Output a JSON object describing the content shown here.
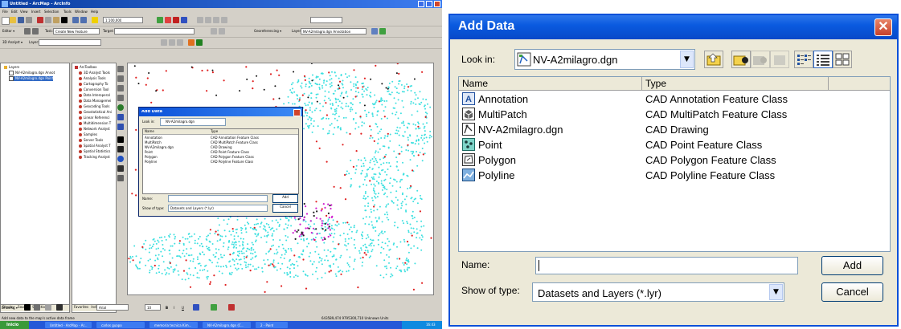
{
  "arcmap": {
    "title": "Untitled - ArcMap - ArcInfo",
    "menu": [
      "File",
      "Edit",
      "View",
      "Insert",
      "Selection",
      "Tools",
      "Window",
      "Help"
    ],
    "toolbar2": {
      "editor": "Editor ▾",
      "task_label": "Task:",
      "task_value": "Create New Feature",
      "target_label": "Target:",
      "georef": "Georeferencing ▾",
      "layer_label": "Layer:",
      "layer_value": "NV-A2milagro.dgn Annotation"
    },
    "toolbar3": {
      "analyst": "3D Analyst ▾",
      "layer_label": "Layer:"
    },
    "zoom": "1:100,000",
    "toc": {
      "root": "Layers",
      "items": [
        "NV-A2milagro.dgn Annot",
        "NV-A2milagro.dgn Point"
      ],
      "tabs": [
        "Display",
        "Source",
        "Selection"
      ]
    },
    "toolbox": {
      "root": "ArcToolbox",
      "items": [
        "3D Analyst Tools",
        "Analysis Tools",
        "Cartography To",
        "Conversion Tool",
        "Data Interoperal",
        "Data Managemei",
        "Geocoding Tools",
        "Geostatistical Ani",
        "Linear Referenci",
        "Multidimension T",
        "Network Analyst",
        "Samples",
        "Server Tools",
        "Spatial Analyst T",
        "Spatial Statistics",
        "Tracking Analyst"
      ],
      "tabs": [
        "Favorites",
        "Index",
        "Search"
      ]
    },
    "mini_dialog": {
      "title": "Add Data",
      "lookin_label": "Look in:",
      "lookin_value": "NV-A2milagro.dgn",
      "col_name": "Name",
      "col_type": "Type",
      "rows": [
        {
          "name": "Annotation",
          "type": "CAD Annotation Feature Class"
        },
        {
          "name": "MultiPatch",
          "type": "CAD MultiPatch Feature Class"
        },
        {
          "name": "NV-A2milagro.dgn",
          "type": "CAD Drawing"
        },
        {
          "name": "Point",
          "type": "CAD Point Feature Class"
        },
        {
          "name": "Polygon",
          "type": "CAD Polygon Feature Class"
        },
        {
          "name": "Polyline",
          "type": "CAD Polyline Feature Class"
        }
      ],
      "name_label": "Name:",
      "type_label": "Show of type:",
      "type_value": "Datasets and Layers (*.lyr)",
      "add": "Add",
      "cancel": "Cancel"
    },
    "drawing": {
      "label": "Drawing ▾",
      "font": "Arial",
      "size": "10",
      "bold": "B",
      "italic": "I",
      "underline": "U"
    },
    "status": {
      "message": "Add new data to the map's active data frame",
      "coords": "643589,474  9795300,710 Unknown Units"
    },
    "taskbar": {
      "start": "Inicio",
      "tasks": [
        "Untitled - ArcMap - Ar...",
        "carlos guapo",
        "memoria tecnica Kim...",
        "NV-A2milagro.dgn (C...",
        "2 - Paint"
      ],
      "clock": "16:43"
    }
  },
  "dialog": {
    "title": "Add Data",
    "close": "✕",
    "lookin_label": "Look in:",
    "lookin_value": "NV-A2milagro.dgn",
    "columns": {
      "name": "Name",
      "type": "Type"
    },
    "rows": [
      {
        "name": "Annotation",
        "type": "CAD Annotation Feature Class",
        "icon": "annotation-icon"
      },
      {
        "name": "MultiPatch",
        "type": "CAD MultiPatch Feature Class",
        "icon": "multipatch-icon"
      },
      {
        "name": "NV-A2milagro.dgn",
        "type": "CAD Drawing",
        "icon": "cad-drawing-icon"
      },
      {
        "name": "Point",
        "type": "CAD Point Feature Class",
        "icon": "point-icon"
      },
      {
        "name": "Polygon",
        "type": "CAD Polygon Feature Class",
        "icon": "polygon-icon"
      },
      {
        "name": "Polyline",
        "type": "CAD Polyline Feature Class",
        "icon": "polyline-icon"
      }
    ],
    "name_label": "Name:",
    "name_value": "",
    "type_label": "Show of type:",
    "type_value": "Datasets and Layers (*.lyr)",
    "add": "Add",
    "cancel": "Cancel"
  },
  "colors": {
    "title_blue": "#0a5be0",
    "map_cyan": "#3ee0e0",
    "map_red": "#e02020",
    "map_magenta": "#d020d0"
  }
}
